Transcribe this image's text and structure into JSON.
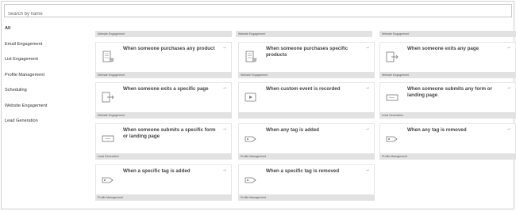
{
  "search": {
    "placeholder": "Search by name"
  },
  "sidebar": {
    "items": [
      {
        "label": "All"
      },
      {
        "label": "Email Engagement"
      },
      {
        "label": "List Engagement"
      },
      {
        "label": "Profile Management"
      },
      {
        "label": "Scheduling"
      },
      {
        "label": "Website Engagement"
      },
      {
        "label": "Lead Generation"
      }
    ]
  },
  "top_row": {
    "categories": [
      "Website Engagement",
      "Website Engagement",
      "Website Engagement"
    ]
  },
  "cards": [
    {
      "title": "When someone purchases any product",
      "category": "Website Engagement",
      "icon": "purchase-icon",
      "arrow": "→"
    },
    {
      "title": "When someone purchases specific products",
      "category": "Website Engagement",
      "icon": "purchase-icon",
      "arrow": "→"
    },
    {
      "title": "When someone exits any page",
      "category": "Website Engagement",
      "icon": "exit-page-icon",
      "arrow": "→"
    },
    {
      "title": "When someone exits a specific page",
      "category": "Website Engagement",
      "icon": "exit-page-icon",
      "arrow": "→"
    },
    {
      "title": "When custom event is recorded",
      "category": "",
      "icon": "video-event-icon",
      "arrow": "→"
    },
    {
      "title": "When someone submits any form or landing page",
      "category": "Lead Generation",
      "icon": "form-icon",
      "arrow": "→"
    },
    {
      "title": "When someone submits a specific form or landing page",
      "category": "Lead Generation",
      "icon": "form-icon",
      "arrow": "→"
    },
    {
      "title": "When any tag is added",
      "category": "Profile Management",
      "icon": "tag-icon",
      "arrow": "→"
    },
    {
      "title": "When any tag is removed",
      "category": "Profile Management",
      "icon": "tag-icon",
      "arrow": "→"
    },
    {
      "title": "When a specific tag is added",
      "category": "Profile Management",
      "icon": "tag-icon",
      "arrow": "→"
    },
    {
      "title": "When a specific tag is removed",
      "category": "Profile Management",
      "icon": "tag-icon",
      "arrow": "→"
    }
  ]
}
